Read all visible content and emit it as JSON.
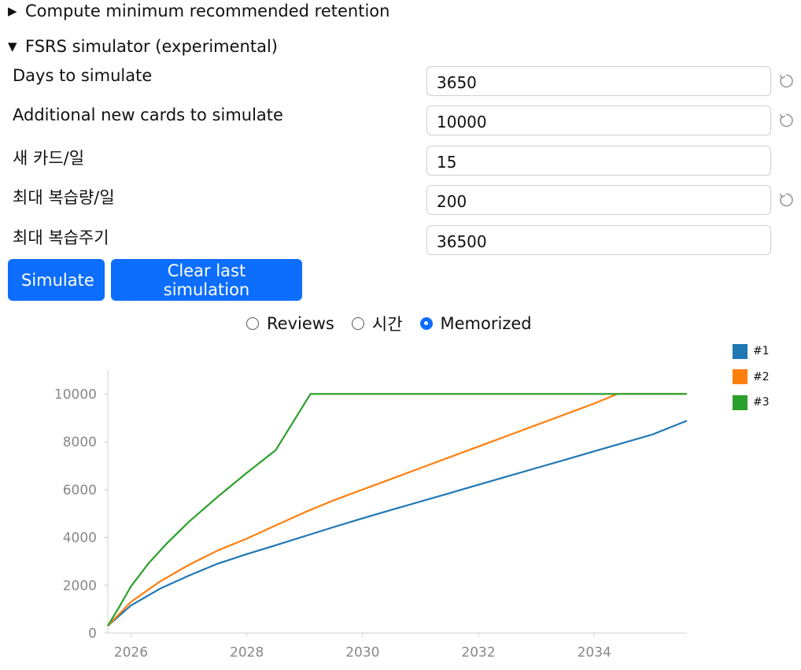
{
  "sections": {
    "compute_retention": {
      "label": "Compute minimum recommended retention",
      "expanded": false
    },
    "simulator": {
      "label": "FSRS simulator (experimental)",
      "expanded": true
    }
  },
  "fields": [
    {
      "label": "Days to simulate",
      "value": "3650",
      "reset": true
    },
    {
      "label": "Additional new cards to simulate",
      "value": "10000",
      "reset": true
    },
    {
      "label": "새 카드/일",
      "value": "15",
      "reset": false
    },
    {
      "label": "최대 복습량/일",
      "value": "200",
      "reset": true
    },
    {
      "label": "최대 복습주기",
      "value": "36500",
      "reset": false
    }
  ],
  "buttons": {
    "simulate": "Simulate",
    "clear": "Clear last simulation"
  },
  "radios": [
    {
      "label": "Reviews",
      "checked": false
    },
    {
      "label": "시간",
      "checked": false
    },
    {
      "label": "Memorized",
      "checked": true
    }
  ],
  "icons": {
    "collapsed": "triangle-right-icon",
    "expanded": "triangle-down-icon",
    "reset": "reset-icon"
  },
  "chart_data": {
    "type": "line",
    "xlabel": "",
    "ylabel": "",
    "xlim": [
      2025.6,
      2035.6
    ],
    "ylim": [
      0,
      11000
    ],
    "xticks": [
      "2026",
      "2028",
      "2030",
      "2032",
      "2034"
    ],
    "yticks": [
      "0",
      "2000",
      "4000",
      "6000",
      "8000",
      "10000"
    ],
    "legend_position": "top-right",
    "series": [
      {
        "name": "#1",
        "color": "#1f77b4",
        "x": [
          2025.6,
          2026.0,
          2026.5,
          2027.0,
          2027.5,
          2028.0,
          2028.5,
          2029.0,
          2029.5,
          2030.0,
          2030.5,
          2031.0,
          2031.5,
          2032.0,
          2032.5,
          2033.0,
          2033.5,
          2034.0,
          2034.5,
          2035.0,
          2035.6
        ],
        "y": [
          300,
          1150,
          1850,
          2400,
          2900,
          3300,
          3670,
          4050,
          4430,
          4800,
          5150,
          5500,
          5850,
          6200,
          6550,
          6900,
          7250,
          7600,
          7950,
          8300,
          8880
        ]
      },
      {
        "name": "#2",
        "color": "#ff7f0e",
        "x": [
          2025.6,
          2026.0,
          2026.5,
          2027.0,
          2027.5,
          2028.0,
          2028.5,
          2029.0,
          2029.5,
          2030.0,
          2030.5,
          2031.0,
          2031.5,
          2032.0,
          2032.5,
          2033.0,
          2033.5,
          2034.0,
          2034.4,
          2035.0,
          2035.6
        ],
        "y": [
          300,
          1300,
          2150,
          2850,
          3450,
          3950,
          4500,
          5050,
          5550,
          6000,
          6450,
          6900,
          7350,
          7800,
          8250,
          8700,
          9150,
          9600,
          10000,
          10000,
          10000
        ]
      },
      {
        "name": "#3",
        "color": "#2ca02c",
        "x": [
          2025.6,
          2025.8,
          2026.0,
          2026.3,
          2026.6,
          2027.0,
          2027.5,
          2028.0,
          2028.5,
          2029.1,
          2029.5,
          2030.0,
          2031.0,
          2032.0,
          2033.0,
          2034.0,
          2035.0,
          2035.6
        ],
        "y": [
          300,
          1100,
          1950,
          2900,
          3700,
          4650,
          5700,
          6700,
          7650,
          10000,
          10000,
          10000,
          10000,
          10000,
          10000,
          10000,
          10000,
          10000
        ]
      }
    ]
  }
}
